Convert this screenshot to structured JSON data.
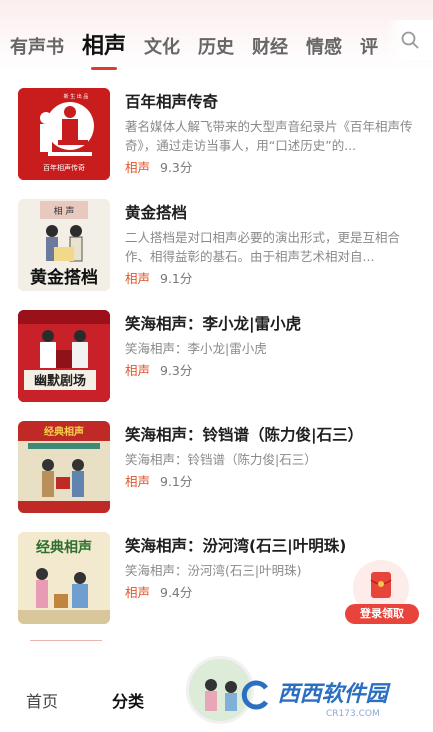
{
  "tabs": [
    {
      "label": "有声书",
      "active": false
    },
    {
      "label": "相声",
      "active": true
    },
    {
      "label": "文化",
      "active": false
    },
    {
      "label": "历史",
      "active": false
    },
    {
      "label": "财经",
      "active": false
    },
    {
      "label": "情感",
      "active": false
    },
    {
      "label": "评",
      "active": false
    }
  ],
  "accent_color": "#e03a32",
  "items": [
    {
      "title": "百年相声传奇",
      "desc": "著名媒体人解飞带来的大型声音纪录片《百年相声传奇》，通过走访当事人，用“口述历史”的...",
      "tag": "相声",
      "score": "9.3分",
      "cover_text": [
        "百年相声传奇",
        "新 生 出 品"
      ]
    },
    {
      "title": "黄金搭档",
      "desc": "二人搭档是对口相声必要的演出形式，更是互相合作、相得益彰的基石。由于相声艺术相对自...",
      "tag": "相声",
      "score": "9.1分",
      "cover_text": [
        "黄金搭档",
        "相 声"
      ]
    },
    {
      "title": "笑海相声：李小龙|雷小虎",
      "desc": "笑海相声：李小龙|雷小虎",
      "tag": "相声",
      "score": "9.3分",
      "cover_text": [
        "幽默剧场"
      ]
    },
    {
      "title": "笑海相声：铃铛谱（陈力俊|石三）",
      "desc": "笑海相声：铃铛谱（陈力俊|石三）",
      "tag": "相声",
      "score": "9.1分",
      "cover_text": [
        "经典相声"
      ]
    },
    {
      "title": "笑海相声：汾河湾(石三|叶明珠)",
      "desc": "笑海相声：汾河湾(石三|叶明珠)",
      "tag": "相声",
      "score": "9.4分",
      "cover_text": [
        "经典相声"
      ]
    }
  ],
  "promo": {
    "label": "登录领取"
  },
  "bottom_nav": [
    {
      "label": "首页",
      "active": false
    },
    {
      "label": "分类",
      "active": true
    }
  ],
  "watermark": {
    "text": "西西软件园",
    "sub": "CR173.COM"
  }
}
